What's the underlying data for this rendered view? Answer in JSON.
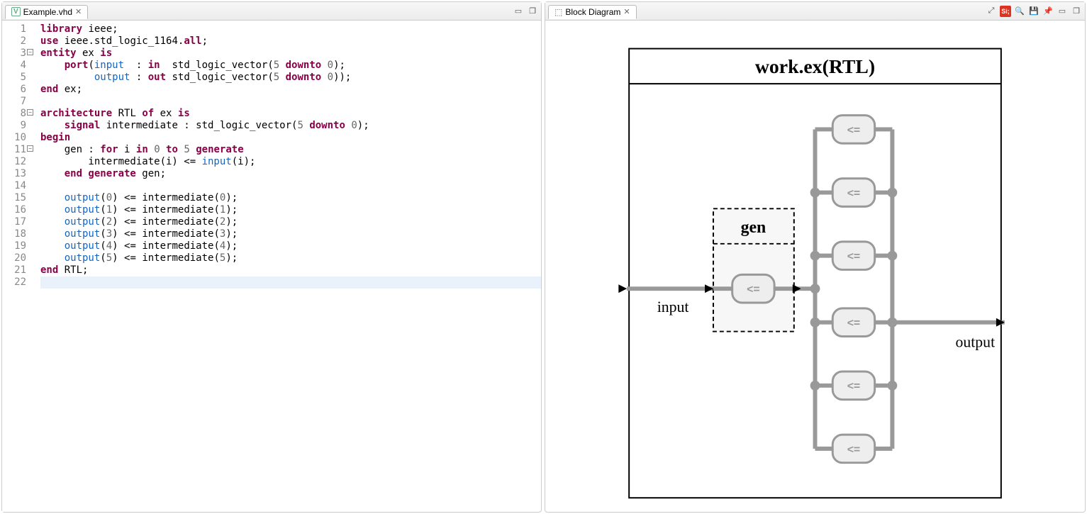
{
  "left": {
    "tab_title": "Example.vhd",
    "line_numbers": [
      "1",
      "2",
      "3",
      "4",
      "5",
      "6",
      "7",
      "8",
      "9",
      "10",
      "11",
      "12",
      "13",
      "14",
      "15",
      "16",
      "17",
      "18",
      "19",
      "20",
      "21",
      "22"
    ],
    "fold_lines": [
      3,
      8,
      11
    ],
    "code": {
      "l1": {
        "a": "library",
        "b": " ieee;"
      },
      "l2": {
        "a": "use",
        "b": " ieee.std_logic_1164.",
        "c": "all",
        "d": ";"
      },
      "l3": {
        "a": "entity",
        "b": " ex ",
        "c": "is"
      },
      "l4": {
        "a": "    port",
        "b": "(",
        "c": "input",
        "d": "  : ",
        "e": "in",
        "f": "  std_logic_vector(",
        "g": "5",
        "h": " downto ",
        "i": "0",
        "j": ");"
      },
      "l5": {
        "a": "         ",
        "b": "output",
        "c": " : ",
        "d": "out",
        "e": " std_logic_vector(",
        "f": "5",
        "g": " downto ",
        "h": "0",
        "i": "));"
      },
      "l6": {
        "a": "end",
        "b": " ex;"
      },
      "l7": "",
      "l8": {
        "a": "architecture",
        "b": " RTL ",
        "c": "of",
        "d": " ex ",
        "e": "is"
      },
      "l9": {
        "a": "    signal",
        "b": " intermediate : ",
        "c": "std_logic_vector",
        "d": "(",
        "e": "5",
        "f": " downto ",
        "g": "0",
        "h": ");"
      },
      "l10": {
        "a": "begin"
      },
      "l11": {
        "a": "    gen : ",
        "b": "for",
        "c": " i ",
        "d": "in",
        "e": " ",
        "f": "0",
        "g": " to ",
        "h": "5",
        "i": " generate"
      },
      "l12": {
        "a": "        intermediate(i) <= ",
        "b": "input",
        "c": "(i);"
      },
      "l13": {
        "a": "    end generate",
        "b": " gen;"
      },
      "l14": "",
      "l15": {
        "a": "    ",
        "b": "output",
        "c": "(",
        "d": "0",
        "e": ") <= intermediate(",
        "f": "0",
        "g": ");"
      },
      "l16": {
        "a": "    ",
        "b": "output",
        "c": "(",
        "d": "1",
        "e": ") <= intermediate(",
        "f": "1",
        "g": ");"
      },
      "l17": {
        "a": "    ",
        "b": "output",
        "c": "(",
        "d": "2",
        "e": ") <= intermediate(",
        "f": "2",
        "g": ");"
      },
      "l18": {
        "a": "    ",
        "b": "output",
        "c": "(",
        "d": "3",
        "e": ") <= intermediate(",
        "f": "3",
        "g": ");"
      },
      "l19": {
        "a": "    ",
        "b": "output",
        "c": "(",
        "d": "4",
        "e": ") <= intermediate(",
        "f": "4",
        "g": ");"
      },
      "l20": {
        "a": "    ",
        "b": "output",
        "c": "(",
        "d": "5",
        "e": ") <= intermediate(",
        "f": "5",
        "g": ");"
      },
      "l21": {
        "a": "end",
        "b": " RTL;"
      }
    }
  },
  "right": {
    "tab_title": "Block Diagram",
    "diagram": {
      "title": "work.ex(RTL)",
      "gen_label": "gen",
      "input_label": "input",
      "output_label": "output",
      "assign_symbol": "<=",
      "assign_count": 7
    }
  }
}
